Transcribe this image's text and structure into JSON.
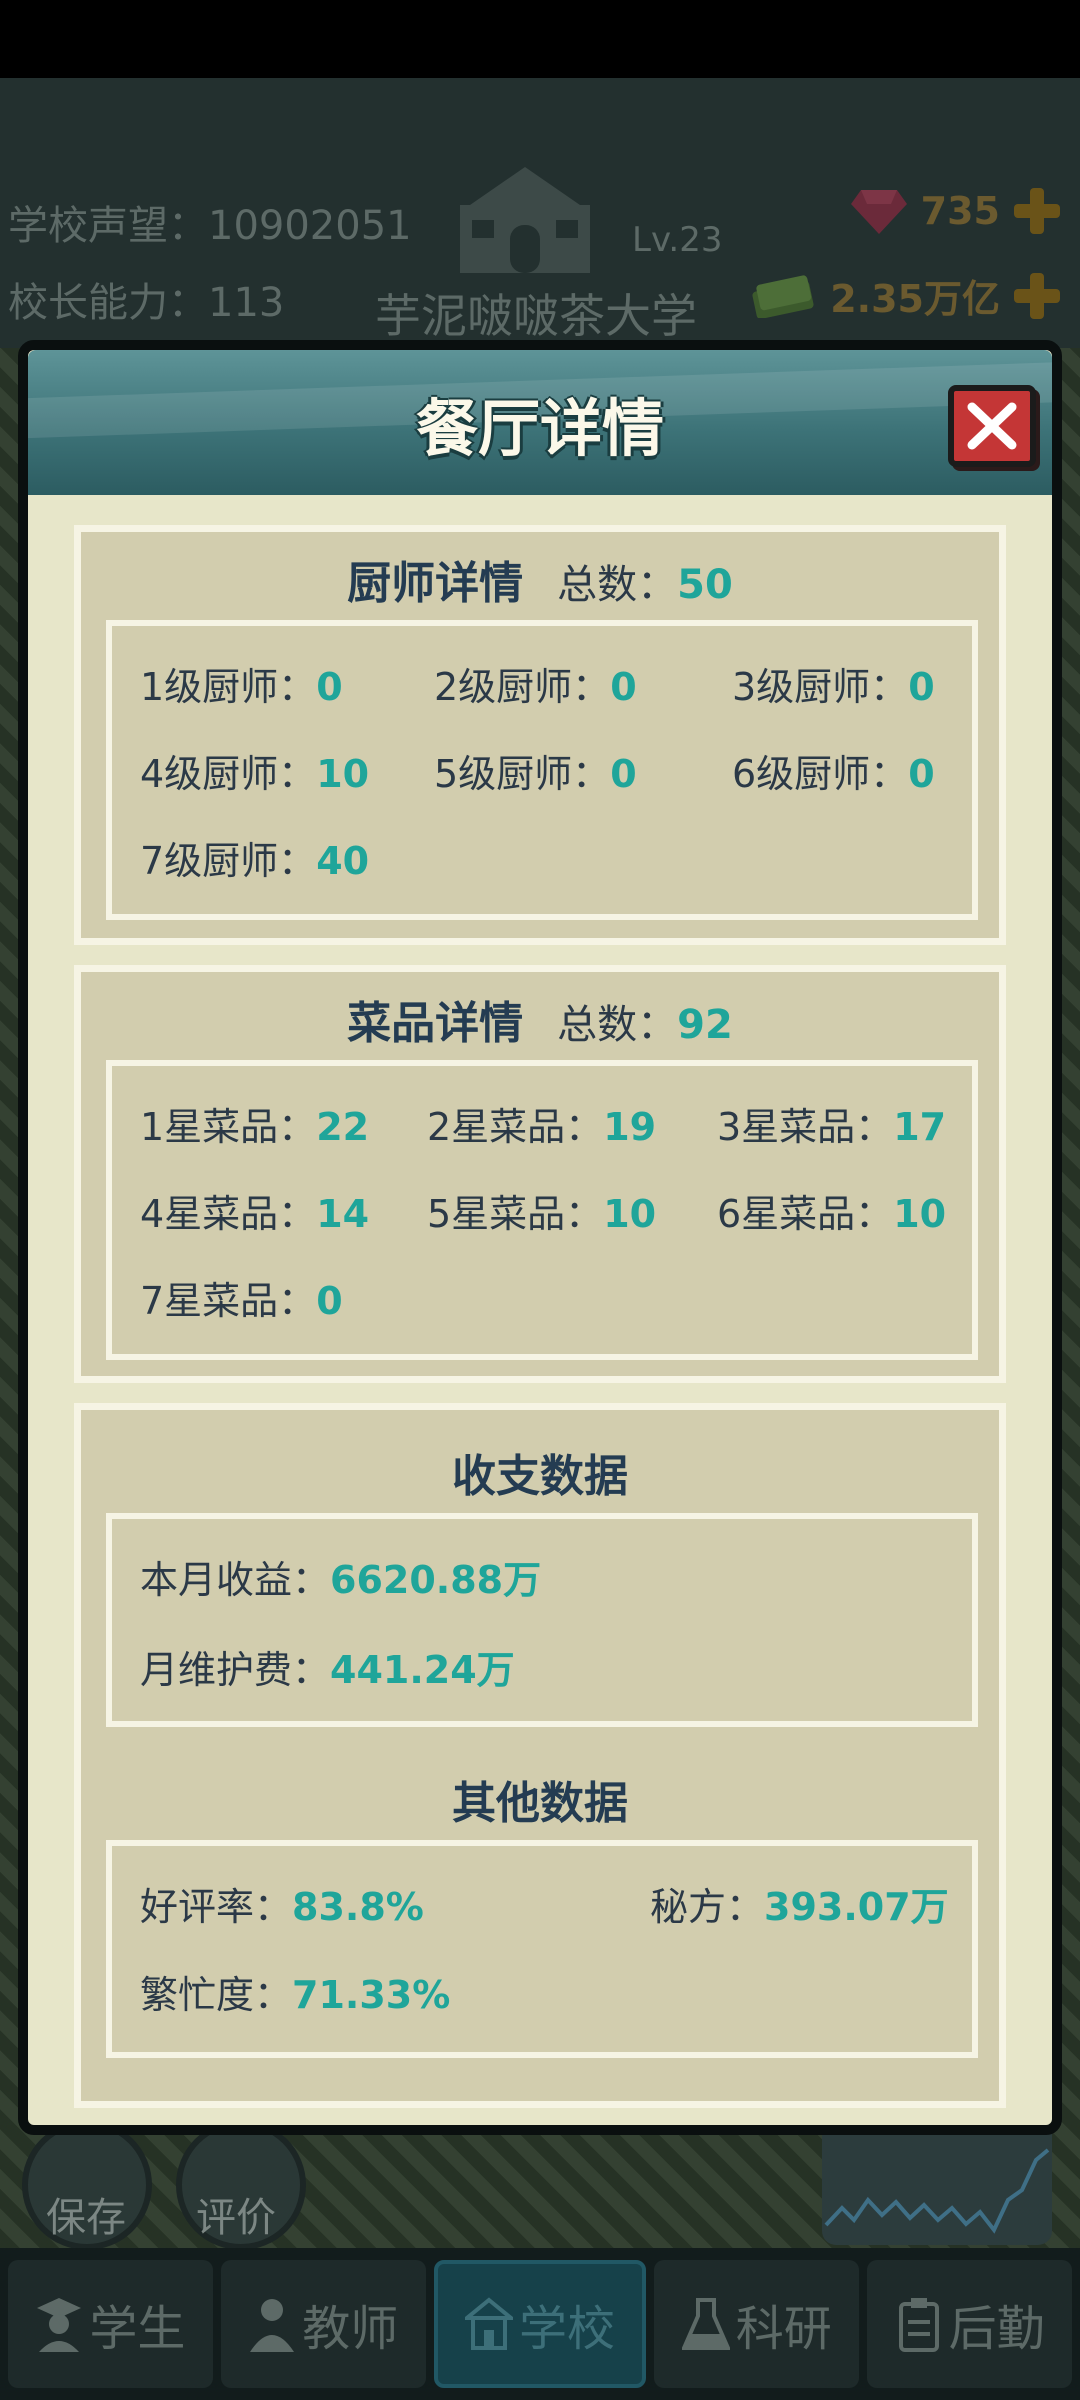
{
  "hud": {
    "reputation_label": "学校声望：",
    "reputation_value": "10902051",
    "ability_label": "校长能力：",
    "ability_value": "113",
    "school_level": "Lv.23",
    "school_name": "芋泥啵啵茶大学",
    "gems": "735",
    "money": "2.35万亿"
  },
  "dialog": {
    "title": "餐厅详情",
    "chef_section": {
      "heading": "厨师详情",
      "total_label": "总数：",
      "total_value": "50",
      "items": [
        {
          "label": "1级厨师：",
          "value": "0"
        },
        {
          "label": "2级厨师：",
          "value": "0"
        },
        {
          "label": "3级厨师：",
          "value": "0"
        },
        {
          "label": "4级厨师：",
          "value": "10"
        },
        {
          "label": "5级厨师：",
          "value": "0"
        },
        {
          "label": "6级厨师：",
          "value": "0"
        },
        {
          "label": "7级厨师：",
          "value": "40"
        }
      ]
    },
    "dish_section": {
      "heading": "菜品详情",
      "total_label": "总数：",
      "total_value": "92",
      "items": [
        {
          "label": "1星菜品：",
          "value": "22"
        },
        {
          "label": "2星菜品：",
          "value": "19"
        },
        {
          "label": "3星菜品：",
          "value": "17"
        },
        {
          "label": "4星菜品：",
          "value": "14"
        },
        {
          "label": "5星菜品：",
          "value": "10"
        },
        {
          "label": "6星菜品：",
          "value": "10"
        },
        {
          "label": "7星菜品：",
          "value": "0"
        }
      ]
    },
    "finance_section": {
      "heading": "收支数据",
      "items": [
        {
          "label": "本月收益：",
          "value": "6620.88万"
        },
        {
          "label": "月维护费：",
          "value": "441.24万"
        }
      ]
    },
    "other_section": {
      "heading": "其他数据",
      "items": [
        {
          "label": "好评率：",
          "value": "83.8%"
        },
        {
          "label": "秘方：",
          "value": "393.07万"
        },
        {
          "label": "繁忙度：",
          "value": "71.33%"
        }
      ]
    }
  },
  "side_buttons": {
    "save": "保存",
    "rate": "评价"
  },
  "nav": {
    "tabs": [
      "学生",
      "教师",
      "学校",
      "科研",
      "后勤"
    ],
    "active": "学校"
  },
  "colors": {
    "accent_value": "#1fa59a",
    "header_teal": "#3d7378",
    "panel_bg": "#d2cdae",
    "close_red": "#c43636"
  }
}
